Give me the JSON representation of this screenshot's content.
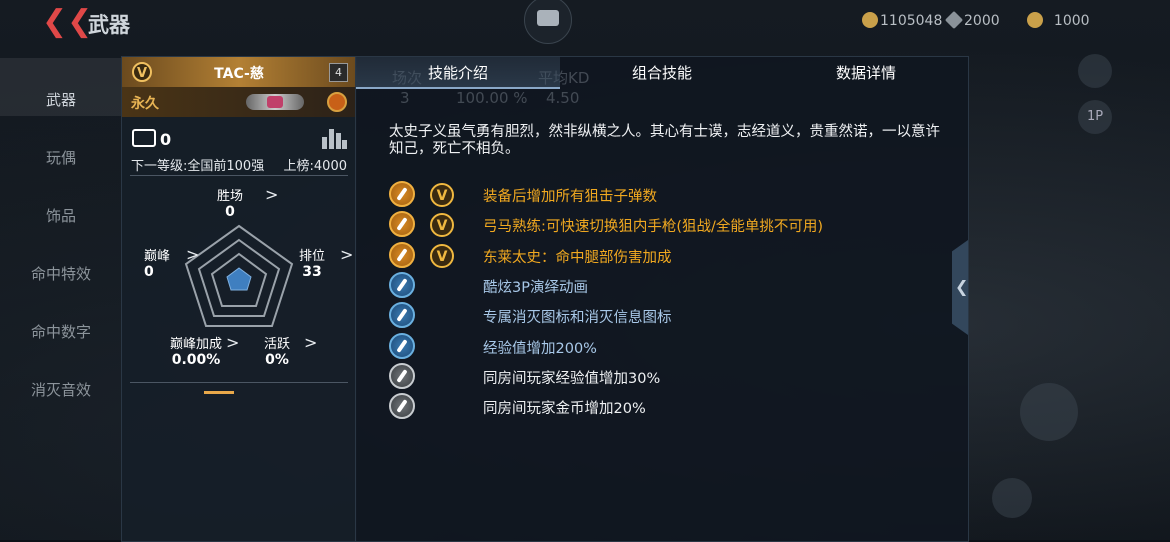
{
  "header": {
    "title": "武器",
    "currencies": [
      {
        "value": "1105048",
        "icon": "gold-coin-icon",
        "color": "#c9a04a"
      },
      {
        "value": "2000",
        "icon": "diamond-icon",
        "color": "#9aa2aa"
      },
      {
        "value": "1000",
        "icon": "token-icon",
        "color": "#c9a04a"
      }
    ]
  },
  "sidebar": {
    "items": [
      {
        "label": "武器",
        "active": true
      },
      {
        "label": "玩偶",
        "active": false
      },
      {
        "label": "饰品",
        "active": false
      },
      {
        "label": "命中特效",
        "active": false
      },
      {
        "label": "命中数字",
        "active": false
      },
      {
        "label": "消灭音效",
        "active": false
      }
    ]
  },
  "weapon": {
    "name": "TAC-慈",
    "level": "4",
    "duration": "永久",
    "kills": "0",
    "next_level": "下一等级:全国前100强",
    "listed": "上榜:4000",
    "stats": {
      "battlefield": {
        "label": "胜场",
        "value": "0"
      },
      "peak": {
        "label": "巅峰",
        "value": "0"
      },
      "ranked": {
        "label": "排位",
        "value": "33"
      },
      "peak_bonus": {
        "label": "巅峰加成",
        "value": "0.00%"
      },
      "active": {
        "label": "活跃",
        "value": "0%"
      }
    }
  },
  "tabs": {
    "intro": "技能介绍",
    "combo": "组合技能",
    "data": "数据详情"
  },
  "ghost_stats": {
    "h1": "场次",
    "h2": "",
    "h3": "平均KD",
    "v1": "3",
    "v2": "100.00 %",
    "v3": "4.50"
  },
  "description": "太史子义虽气勇有胆烈，然非纵横之人。其心有士谟，志经道义，贵重然诺，一以意许知己，死亡不相负。",
  "skills": [
    {
      "text": "装备后增加所有狙击子弹数",
      "style": "gold",
      "icon": "sniper-bullet-icon",
      "badge": true
    },
    {
      "text": "弓马熟练:可快速切换狙内手枪(狙战/全能单挑不可用)",
      "style": "gold",
      "icon": "pistol-switch-icon",
      "badge": true
    },
    {
      "text": "东莱太史：命中腿部伤害加成",
      "style": "gold",
      "icon": "leg-damage-icon",
      "badge": true
    },
    {
      "text": "酷炫3P演绎动画",
      "style": "blue",
      "icon": "animation-icon",
      "badge": false
    },
    {
      "text": "专属消灭图标和消灭信息图标",
      "style": "blue",
      "icon": "elimination-icon",
      "badge": false
    },
    {
      "text": "经验值增加200%",
      "style": "blue",
      "icon": "exp-icon",
      "badge": false
    },
    {
      "text": "同房间玩家经验值增加30%",
      "style": "white",
      "icon": "room-exp-icon",
      "badge": false
    },
    {
      "text": "同房间玩家金币增加20%",
      "style": "white",
      "icon": "room-coin-icon",
      "badge": false
    }
  ],
  "right_buttons": {
    "view_1p": "1P"
  }
}
